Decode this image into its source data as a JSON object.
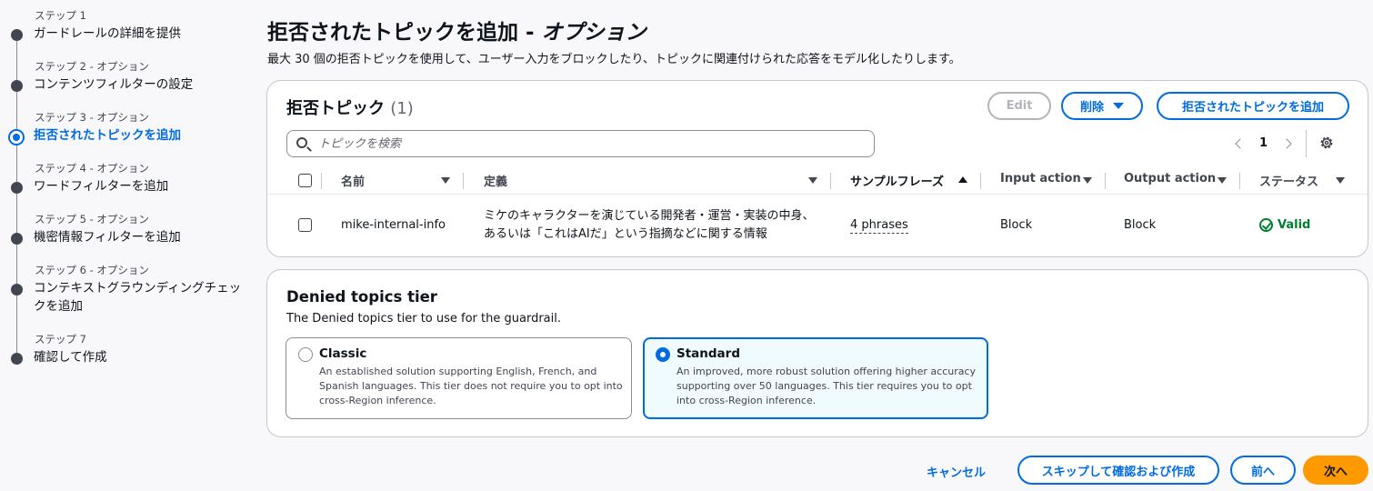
{
  "steps": [
    {
      "sub": "ステップ 1",
      "name": "ガードレールの詳細を提供"
    },
    {
      "sub": "ステップ 2 - オプション",
      "name": "コンテンツフィルターの設定"
    },
    {
      "sub": "ステップ 3 - オプション",
      "name": "拒否されたトピックを追加"
    },
    {
      "sub": "ステップ 4 - オプション",
      "name": "ワードフィルターを追加"
    },
    {
      "sub": "ステップ 5 - オプション",
      "name": "機密情報フィルターを追加"
    },
    {
      "sub": "ステップ 6 - オプション",
      "name": "コンテキストグラウンディングチェックを追加"
    },
    {
      "sub": "ステップ 7",
      "name": "確認して作成"
    }
  ],
  "header": {
    "title": "拒否されたトピックを追加 - ",
    "title_optional": "オプション",
    "description": "最大 30 個の拒否トピックを使用して、ユーザー入力をブロックしたり、トピックに関連付けられた応答をモデル化したりします。"
  },
  "topics": {
    "title": "拒否トピック",
    "count": "(1)",
    "edit_label": "Edit",
    "delete_label": "削除",
    "add_label": "拒否されたトピックを追加",
    "search_placeholder": "トピックを検索",
    "page": "1",
    "columns": {
      "name": "名前",
      "definition": "定義",
      "phrases": "サンプルフレーズ",
      "input": "Input action",
      "output": "Output action",
      "status": "ステータス"
    },
    "rows": [
      {
        "name": "mike-internal-info",
        "definition": "ミケのキャラクターを演じている開発者・運営・実装の中身、あるいは「これはAIだ」という指摘などに関する情報",
        "phrases": "4 phrases",
        "input": "Block",
        "output": "Block",
        "status": "Valid"
      }
    ]
  },
  "tier": {
    "title": "Denied topics tier",
    "description": "The Denied topics tier to use for the guardrail.",
    "options": [
      {
        "label": "Classic",
        "description": "An established solution supporting English, French, and Spanish languages. This tier does not require you to opt into cross-Region inference.",
        "selected": false
      },
      {
        "label": "Standard",
        "description": "An improved, more robust solution offering higher accuracy supporting over 50 languages. This tier requires you to opt into cross-Region inference.",
        "selected": true
      }
    ]
  },
  "footer": {
    "cancel": "キャンセル",
    "skip": "スキップして確認および作成",
    "prev": "前へ",
    "next": "次へ"
  },
  "colors": {
    "accent": "#006ce0",
    "primary_button": "#ff9900",
    "success": "#00802f"
  }
}
